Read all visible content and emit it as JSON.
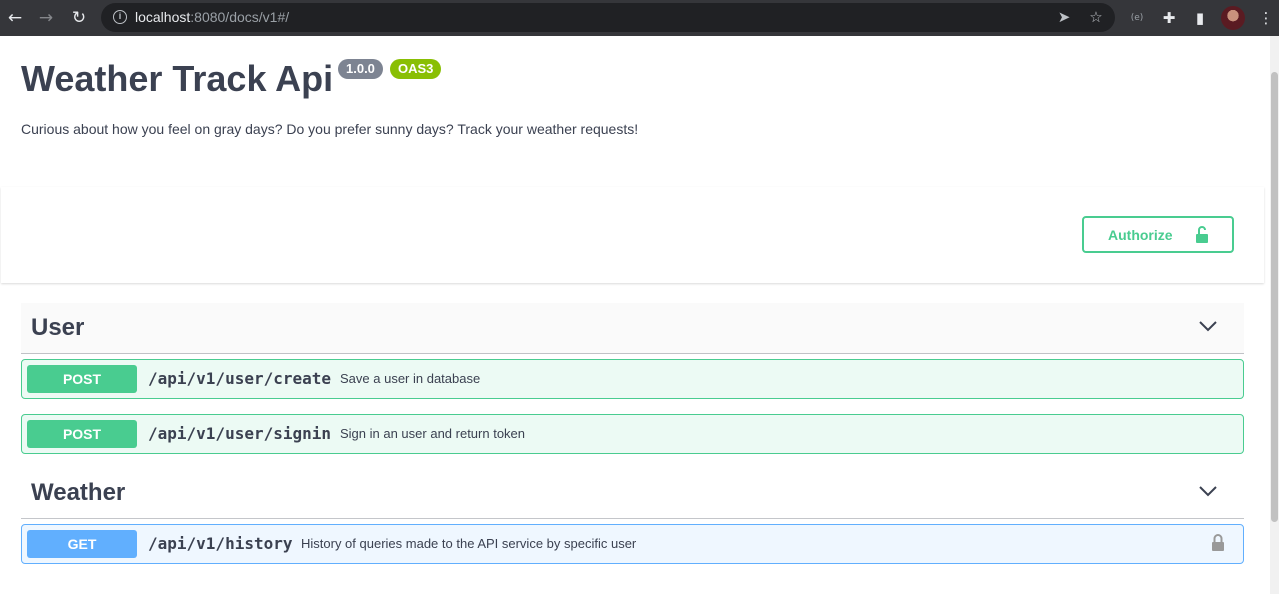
{
  "browser": {
    "url_host": "localhost",
    "url_rest": ":8080/docs/v1#/",
    "icons": [
      "back-arrow-icon",
      "forward-arrow-icon",
      "reload-icon",
      "info-icon",
      "send-icon",
      "star-icon",
      "extension-icon",
      "puzzle-icon",
      "sidebar-icon",
      "avatar",
      "kebab-menu-icon"
    ],
    "extension_label": "(e)"
  },
  "info": {
    "title": "Weather Track Api",
    "version": "1.0.0",
    "oas": "OAS3",
    "description": "Curious about how you feel on gray days? Do you prefer sunny days? Track your weather requests!"
  },
  "authorize": {
    "label": "Authorize"
  },
  "tags": [
    {
      "name": "User",
      "operations": [
        {
          "method": "POST",
          "path": "/api/v1/user/create",
          "summary": "Save a user in database"
        },
        {
          "method": "POST",
          "path": "/api/v1/user/signin",
          "summary": "Sign in an user and return token"
        }
      ]
    },
    {
      "name": "Weather",
      "operations": [
        {
          "method": "GET",
          "path": "/api/v1/history",
          "summary": "History of queries made to the API service by specific user"
        }
      ]
    }
  ],
  "colors": {
    "post": "#49cc90",
    "get": "#61affe",
    "text": "#3b4151",
    "version_badge": "#7d8492",
    "oas_badge": "#89bf04"
  }
}
